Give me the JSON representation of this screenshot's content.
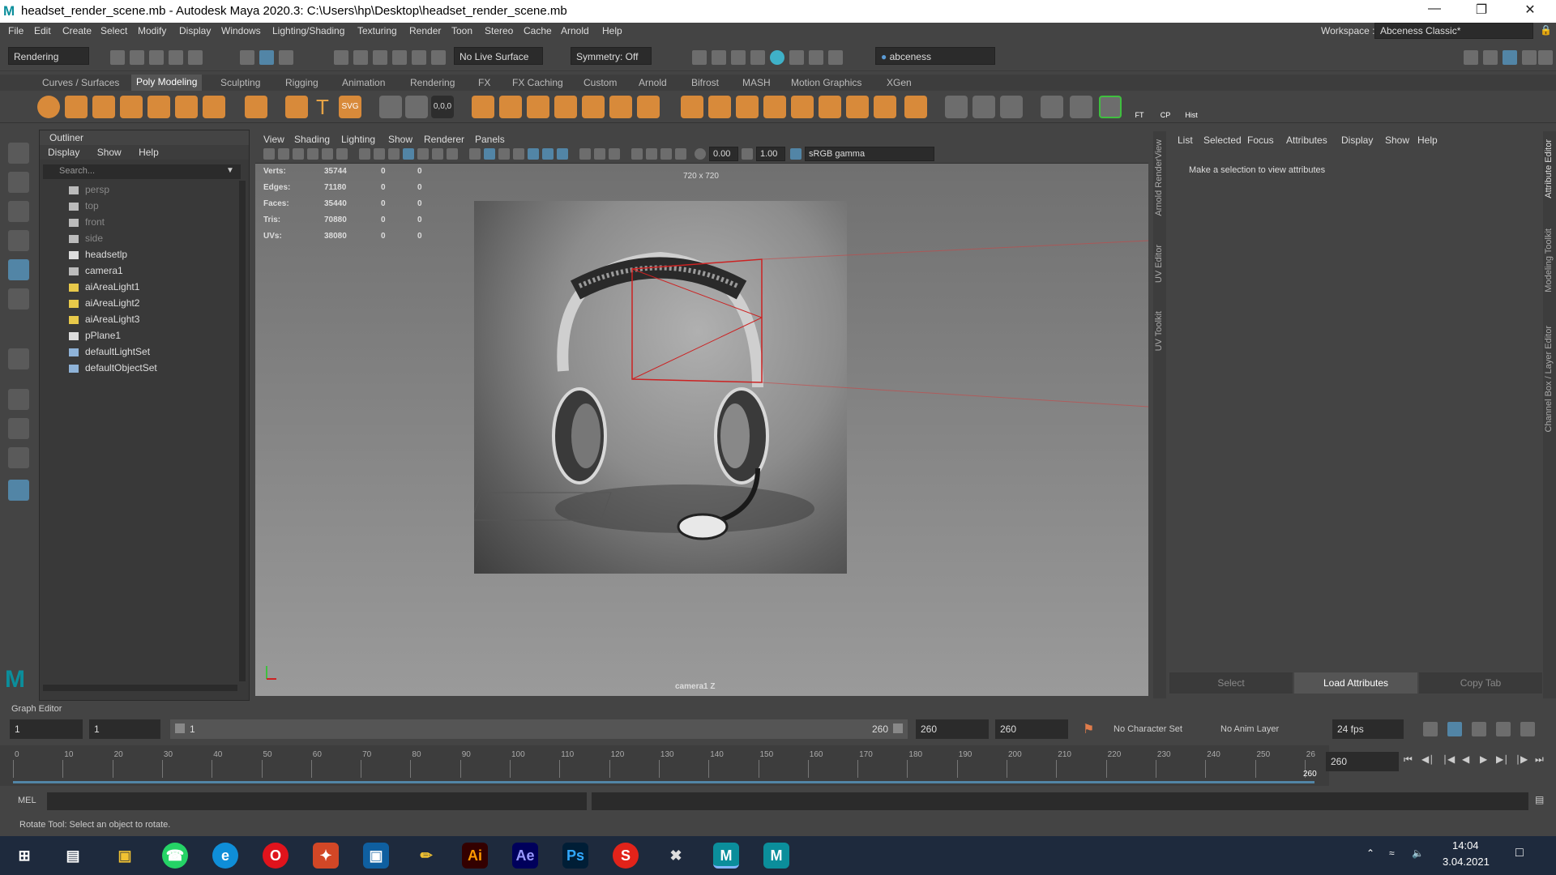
{
  "title": {
    "text": "headset_render_scene.mb - Autodesk Maya 2020.3: C:\\Users\\hp\\Desktop\\headset_render_scene.mb",
    "logo": "M"
  },
  "menu": [
    "File",
    "Edit",
    "Create",
    "Select",
    "Modify",
    "Display",
    "Windows",
    "Lighting/Shading",
    "Texturing",
    "Render",
    "Toon",
    "Stereo",
    "Cache",
    "Arnold",
    "Help"
  ],
  "workspace": {
    "label": "Workspace :",
    "value": "Abceness Classic*"
  },
  "status": {
    "menuset": "Rendering",
    "live_surface": "No Live Surface",
    "symmetry": "Symmetry: Off",
    "user": "abceness"
  },
  "shelf_tabs": [
    "Curves / Surfaces",
    "Poly Modeling",
    "Sculpting",
    "Rigging",
    "Animation",
    "Rendering",
    "FX",
    "FX Caching",
    "Custom",
    "Arnold",
    "Bifrost",
    "MASH",
    "Motion Graphics",
    "XGen"
  ],
  "shelf_active": "Poly Modeling",
  "shelf_labels": {
    "ft": "FT",
    "cp": "CP",
    "hist": "Hist",
    "coords": "0,0,0"
  },
  "outliner": {
    "title": "Outliner",
    "menu": [
      "Display",
      "Show",
      "Help"
    ],
    "search_placeholder": "Search...",
    "items": [
      {
        "label": "persp",
        "dim": true,
        "icon": "camera-icon"
      },
      {
        "label": "top",
        "dim": true,
        "icon": "camera-icon"
      },
      {
        "label": "front",
        "dim": true,
        "icon": "camera-icon"
      },
      {
        "label": "side",
        "dim": true,
        "icon": "camera-icon"
      },
      {
        "label": "headsetlp",
        "dim": false,
        "icon": "mesh-icon"
      },
      {
        "label": "camera1",
        "dim": false,
        "icon": "camera-icon"
      },
      {
        "label": "aiAreaLight1",
        "dim": false,
        "icon": "light-icon"
      },
      {
        "label": "aiAreaLight2",
        "dim": false,
        "icon": "light-icon"
      },
      {
        "label": "aiAreaLight3",
        "dim": false,
        "icon": "light-icon"
      },
      {
        "label": "pPlane1",
        "dim": false,
        "icon": "mesh-icon"
      },
      {
        "label": "defaultLightSet",
        "dim": false,
        "icon": "set-icon"
      },
      {
        "label": "defaultObjectSet",
        "dim": false,
        "icon": "set-icon"
      }
    ]
  },
  "viewport": {
    "menu": [
      "View",
      "Shading",
      "Lighting",
      "Show",
      "Renderer",
      "Panels"
    ],
    "exposure": "0.00",
    "gamma": "1.00",
    "colorspace": "sRGB gamma",
    "resolution": "720 x 720",
    "camera": "camera1 Z",
    "stats": [
      {
        "label": "Verts:",
        "v": "35744",
        "a": "0",
        "b": "0"
      },
      {
        "label": "Edges:",
        "v": "71180",
        "a": "0",
        "b": "0"
      },
      {
        "label": "Faces:",
        "v": "35440",
        "a": "0",
        "b": "0"
      },
      {
        "label": "Tris:",
        "v": "70880",
        "a": "0",
        "b": "0"
      },
      {
        "label": "UVs:",
        "v": "38080",
        "a": "0",
        "b": "0"
      }
    ]
  },
  "side_tabs": [
    "Arnold RenderView",
    "UV Editor",
    "UV Toolkit"
  ],
  "right_tabs": [
    "Attribute Editor",
    "Modeling Toolkit",
    "Channel Box / Layer Editor"
  ],
  "attribute_editor": {
    "menu": [
      "List",
      "Selected",
      "Focus",
      "Attributes",
      "Display",
      "Show",
      "Help"
    ],
    "message": "Make a selection to view attributes",
    "buttons": [
      "Select",
      "Load Attributes",
      "Copy Tab"
    ]
  },
  "graph_editor_label": "Graph Editor",
  "range": {
    "start": "1",
    "anim_start": "1",
    "slider_start": "1",
    "slider_end": "260",
    "end": "260",
    "anim_end": "260",
    "char_set": "No Character Set",
    "anim_layer": "No Anim Layer",
    "fps": "24 fps"
  },
  "timeline": {
    "ticks": [
      "0",
      "10",
      "20",
      "30",
      "40",
      "50",
      "60",
      "70",
      "80",
      "90",
      "100",
      "110",
      "120",
      "130",
      "140",
      "150",
      "160",
      "170",
      "180",
      "190",
      "200",
      "210",
      "220",
      "230",
      "240",
      "250",
      "26"
    ],
    "current_marker": "260",
    "current_frame": "260"
  },
  "mel": {
    "label": "MEL"
  },
  "help_line": "Rotate Tool: Select an object to rotate.",
  "taskbar": {
    "time": "14:04",
    "date": "3.04.2021",
    "apps": [
      "Ai",
      "Ae",
      "Ps",
      "M",
      "M"
    ]
  }
}
